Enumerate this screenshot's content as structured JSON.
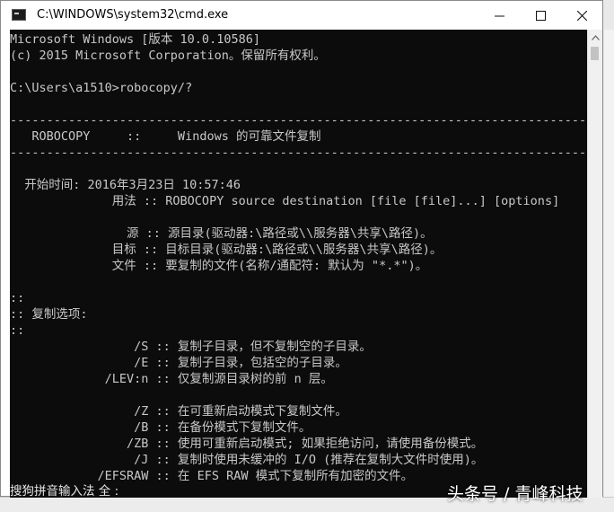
{
  "window": {
    "title": "C:\\WINDOWS\\system32\\cmd.exe",
    "minimize_glyph": "minimize-icon",
    "maximize_glyph": "maximize-icon",
    "close_glyph": "close-icon"
  },
  "console": {
    "lines": [
      "Microsoft Windows [版本 10.0.10586]",
      "(c) 2015 Microsoft Corporation。保留所有权利。",
      "",
      "C:\\Users\\a1510>robocopy/?",
      "",
      "-------------------------------------------------------------------------------",
      "   ROBOCOPY     ::     Windows 的可靠文件复制",
      "-------------------------------------------------------------------------------",
      "",
      "  开始时间: 2016年3月23日 10:57:46",
      "              用法 :: ROBOCOPY source destination [file [file]...] [options]",
      "",
      "                源 :: 源目录(驱动器:\\路径或\\\\服务器\\共享\\路径)。",
      "              目标 :: 目标目录(驱动器:\\路径或\\\\服务器\\共享\\路径)。",
      "              文件 :: 要复制的文件(名称/通配符: 默认为 \"*.*\")。",
      "",
      "::",
      ":: 复制选项:",
      "::",
      "                 /S :: 复制子目录，但不复制空的子目录。",
      "                 /E :: 复制子目录，包括空的子目录。",
      "             /LEV:n :: 仅复制源目录树的前 n 层。",
      "",
      "                 /Z :: 在可重新启动模式下复制文件。",
      "                 /B :: 在备份模式下复制文件。",
      "                /ZB :: 使用可重新启动模式; 如果拒绝访问，请使用备份模式。",
      "                 /J :: 复制时使用未缓冲的 I/O (推荐在复制大文件时使用)。",
      "            /EFSRAW :: 在 EFS RAW 模式下复制所有加密的文件。"
    ],
    "ime_status": "搜狗拼音输入法 全 :"
  },
  "watermark": "头条号 / 青峰科技",
  "colors": {
    "console_bg": "#0c0c0c",
    "console_text": "#c8c8c8",
    "titlebar_bg": "#ffffff"
  }
}
